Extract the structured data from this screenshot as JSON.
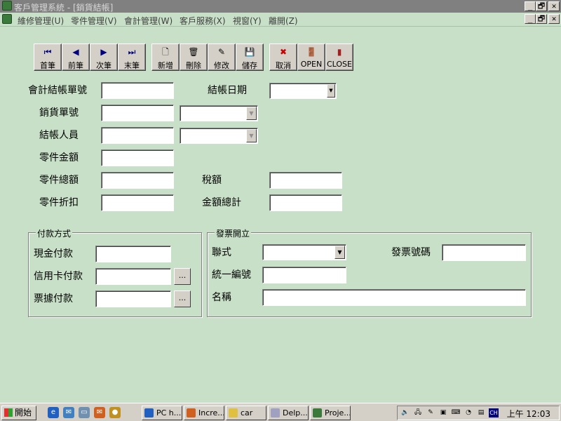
{
  "window": {
    "title": "客戶管理系統 - [銷貨結帳]",
    "controls": [
      "_",
      "🗗",
      "✕"
    ]
  },
  "menubar": {
    "items": [
      "維修管理(U)",
      "零件管理(V)",
      "會計管理(W)",
      "客戶服務(X)",
      "視窗(Y)",
      "離開(Z)"
    ],
    "controls": [
      "_",
      "🗗",
      "✕"
    ]
  },
  "toolbar": {
    "buttons": [
      {
        "label": "首筆",
        "icon": "first-record-icon",
        "glyph": "⏮"
      },
      {
        "label": "前筆",
        "icon": "prev-record-icon",
        "glyph": "◀"
      },
      {
        "label": "次筆",
        "icon": "next-record-icon",
        "glyph": "▶"
      },
      {
        "label": "末筆",
        "icon": "last-record-icon",
        "glyph": "⏭"
      },
      {
        "label": "新增",
        "icon": "new-document-icon",
        "glyph": "🗋"
      },
      {
        "label": "刪除",
        "icon": "trash-icon",
        "glyph": "🗑"
      },
      {
        "label": "修改",
        "icon": "edit-document-icon",
        "glyph": "✎"
      },
      {
        "label": "儲存",
        "icon": "floppy-disk-icon",
        "glyph": "💾"
      },
      {
        "label": "取消",
        "icon": "cancel-x-icon",
        "glyph": "✖"
      },
      {
        "label": "OPEN",
        "icon": "open-door-icon",
        "glyph": "🚪"
      },
      {
        "label": "CLOSE",
        "icon": "close-door-icon",
        "glyph": "▮"
      }
    ],
    "colors": {
      "nav_icon": "#000080",
      "cancel_icon": "#cc0000"
    }
  },
  "form": {
    "labels": {
      "account_no": "會計結帳單號",
      "checkout_date": "結帳日期",
      "sales_no": "銷貨單號",
      "checkout_person": "結帳人員",
      "parts_amount": "零件金額",
      "parts_total": "零件總額",
      "tax": "稅額",
      "parts_discount": "零件折扣",
      "grand_total": "金額總計"
    },
    "values": {
      "account_no": "",
      "checkout_date": "",
      "sales_no": "",
      "sales_no_combo": "",
      "checkout_person": "",
      "checkout_person_combo": "",
      "parts_amount": "",
      "parts_total": "",
      "tax": "",
      "parts_discount": "",
      "grand_total": ""
    }
  },
  "payment": {
    "caption": "付款方式",
    "labels": {
      "cash": "現金付款",
      "credit": "信用卡付款",
      "bill": "票據付款"
    },
    "values": {
      "cash": "",
      "credit": "",
      "bill": ""
    },
    "ellipsis": "..."
  },
  "invoice": {
    "caption": "發票開立",
    "labels": {
      "type": "聯式",
      "number": "發票號碼",
      "tax_id": "統一編號",
      "name": "名稱"
    },
    "values": {
      "type": "",
      "number": "",
      "tax_id": "",
      "name": ""
    }
  },
  "taskbar": {
    "start": "開始",
    "tasks": [
      "PC h...",
      "Incre...",
      "car",
      "Delp...",
      "Proje..."
    ],
    "clock": "上午 12:03",
    "ime": "CH"
  },
  "colors": {
    "background": "#c8e0c8",
    "titlebar": "#808080",
    "face": "#d4d0c8"
  }
}
